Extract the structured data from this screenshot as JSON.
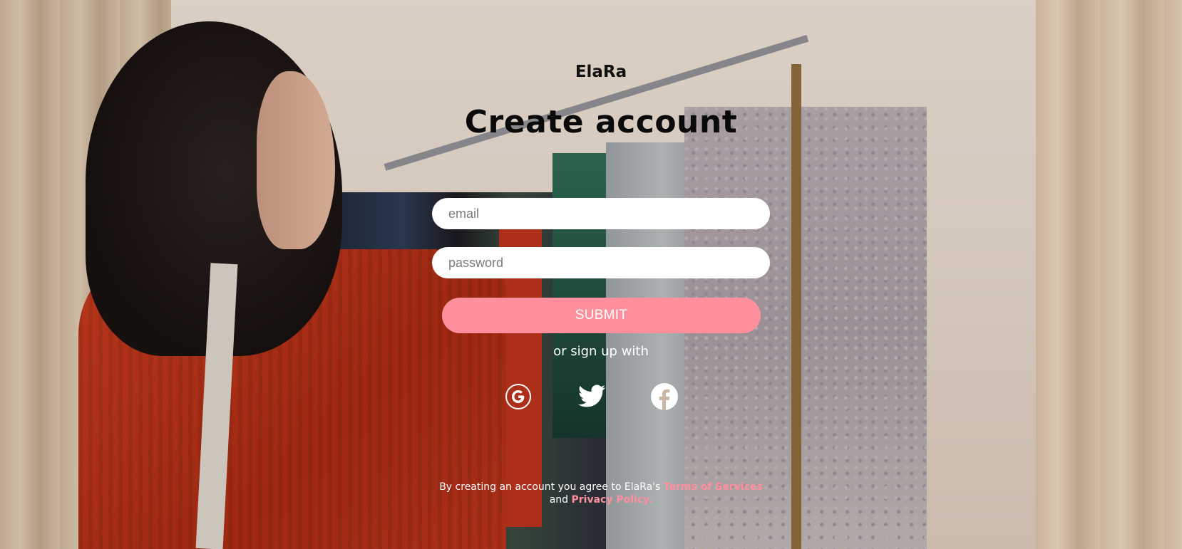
{
  "brand": {
    "name": "ElaRa"
  },
  "form": {
    "title": "Create account",
    "email_placeholder": "email",
    "password_placeholder": "password",
    "submit_label": "SUBMIT",
    "social_prompt": "or sign up with",
    "social_providers": [
      "google-icon",
      "twitter-icon",
      "facebook-icon"
    ]
  },
  "legal": {
    "prefix": "By creating an account you agree to ElaRa's ",
    "terms_link": "Terms of Services",
    "middle": "and ",
    "privacy_link": "Privacy Policy."
  },
  "colors": {
    "accent": "#ff8f9c",
    "input_bg": "#ffffff",
    "text_dark": "#0a0a0a",
    "text_light": "#ffffff"
  }
}
